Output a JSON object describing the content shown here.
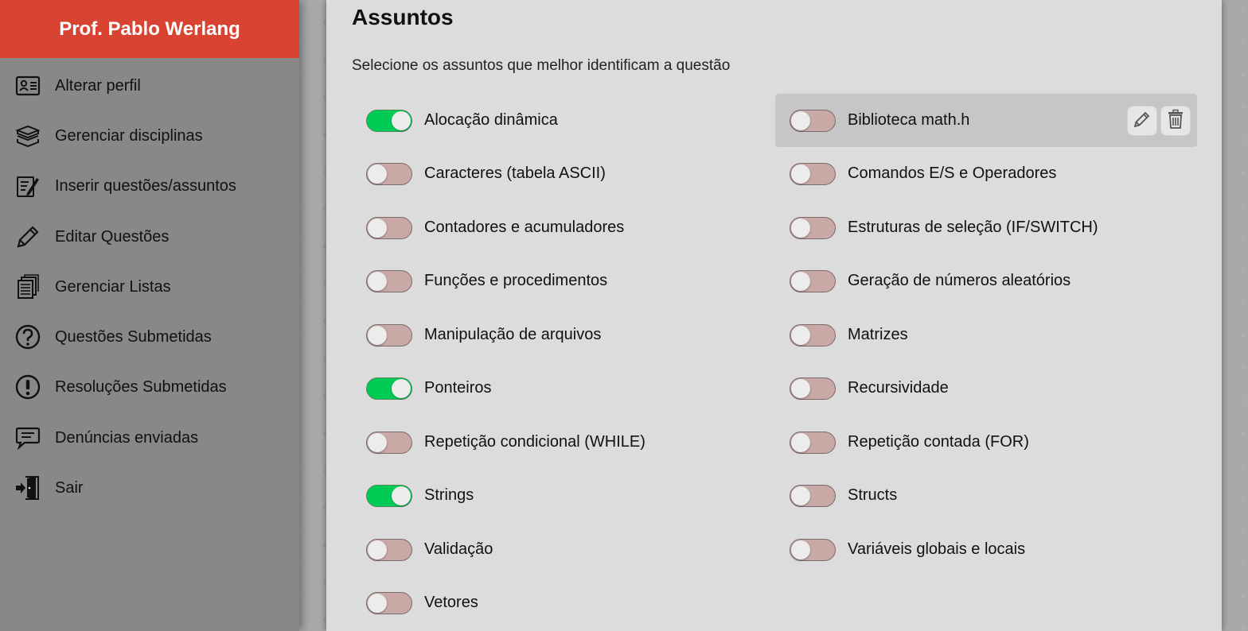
{
  "sidebar": {
    "user_name": "Prof. Pablo Werlang",
    "items": [
      {
        "label": "Alterar perfil",
        "icon": "id-card-icon"
      },
      {
        "label": "Gerenciar disciplinas",
        "icon": "books-icon"
      },
      {
        "label": "Inserir questões/assuntos",
        "icon": "edit-document-icon"
      },
      {
        "label": "Editar Questões",
        "icon": "pencil-icon"
      },
      {
        "label": "Gerenciar Listas",
        "icon": "document-stack-icon"
      },
      {
        "label": "Questões Submetidas",
        "icon": "question-circle-icon"
      },
      {
        "label": "Resoluções Submetidas",
        "icon": "exclamation-circle-icon"
      },
      {
        "label": "Denúncias enviadas",
        "icon": "message-icon"
      },
      {
        "label": "Sair",
        "icon": "exit-door-icon"
      }
    ]
  },
  "main": {
    "title": "Assuntos",
    "subtitle": "Selecione os assuntos que melhor identificam a questão",
    "topics": [
      {
        "label": "Alocação dinâmica",
        "checked": true
      },
      {
        "label": "Biblioteca math.h",
        "checked": false,
        "hovered": true
      },
      {
        "label": "Caracteres (tabela ASCII)",
        "checked": false
      },
      {
        "label": "Comandos E/S e Operadores",
        "checked": false
      },
      {
        "label": "Contadores e acumuladores",
        "checked": false
      },
      {
        "label": "Estruturas de seleção (IF/SWITCH)",
        "checked": false
      },
      {
        "label": "Funções e procedimentos",
        "checked": false
      },
      {
        "label": "Geração de números aleatórios",
        "checked": false
      },
      {
        "label": "Manipulação de arquivos",
        "checked": false
      },
      {
        "label": "Matrizes",
        "checked": false
      },
      {
        "label": "Ponteiros",
        "checked": true
      },
      {
        "label": "Recursividade",
        "checked": false
      },
      {
        "label": "Repetição condicional (WHILE)",
        "checked": false
      },
      {
        "label": "Repetição contada (FOR)",
        "checked": false
      },
      {
        "label": "Strings",
        "checked": true
      },
      {
        "label": "Structs",
        "checked": false
      },
      {
        "label": "Validação",
        "checked": false
      },
      {
        "label": "Variáveis globais e locais",
        "checked": false
      },
      {
        "label": "Vetores",
        "checked": false
      }
    ]
  },
  "colors": {
    "header_red": "#d94432",
    "toggle_on": "#00cc55",
    "toggle_off": "#c9a9a6"
  }
}
